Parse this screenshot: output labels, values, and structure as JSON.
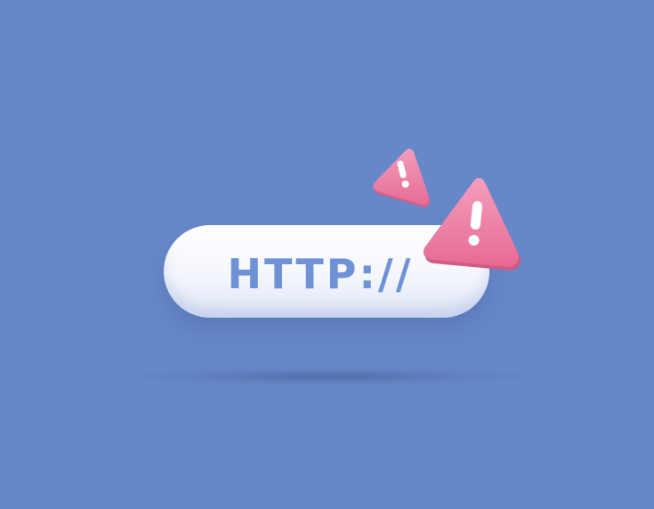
{
  "scene": {
    "background_color": "#6788c8",
    "url_bar": {
      "text": "HTTP://",
      "text_color": "#6f91d6",
      "fill_color": "#ffffff"
    },
    "warnings": [
      {
        "icon": "warning-triangle-icon",
        "glyph": "!",
        "color": "#ee7fa4"
      },
      {
        "icon": "warning-triangle-icon",
        "glyph": "!",
        "color": "#ee7fa4"
      }
    ]
  }
}
